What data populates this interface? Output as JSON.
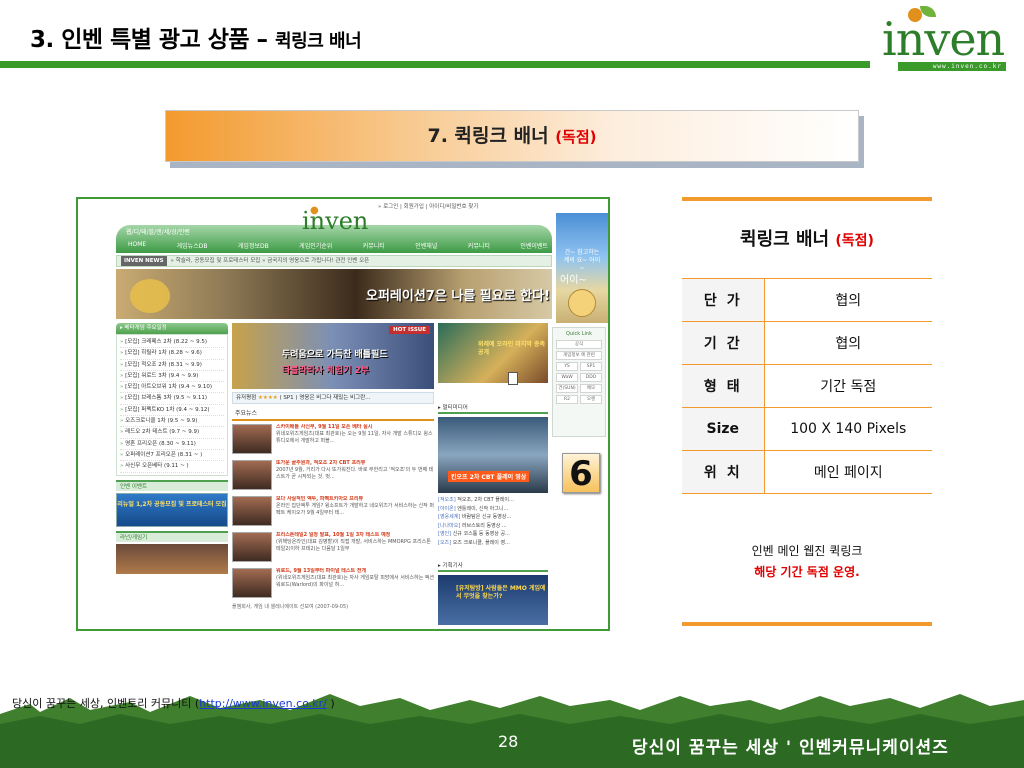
{
  "header": {
    "title": "3. 인벤 특별 광고 상품 –",
    "subtitle": "퀵링크 배너",
    "logo_text": "nven",
    "logo_url": "www.inven.co.kr"
  },
  "product": {
    "label": "7. 퀵링크 배너",
    "tag": "(독점)"
  },
  "badge": "6",
  "spec": {
    "title": "퀵링크 배너",
    "title_tag": "(독점)",
    "rows": [
      {
        "key": "단가",
        "value": "협의"
      },
      {
        "key": "기간",
        "value": "협의"
      },
      {
        "key": "형태",
        "value": "기간 독점"
      },
      {
        "key": "Size",
        "value": "100 X 140 Pixels"
      },
      {
        "key": "위치",
        "value": "메인 페이지"
      }
    ],
    "desc1": "인벤 메인 웹진 퀵링크",
    "desc2": "해당 기간 독점 운영."
  },
  "footer": {
    "note_prefix": "당신이 꿈꾸는 세상, 인벤토리 커뮤니티 (",
    "note_link": "http://www.inven.co.kr/",
    "note_suffix": " )",
    "page_number": "28",
    "slogan": "당신이 꿈꾸는 세상 ' 인벤커뮤니케이션즈"
  },
  "mock": {
    "top_links": "» 로그인 | 회원가입 | 아이디/비밀번호 찾기",
    "nav_breadcrumb": "웹/디/돼/블/앤/세/상/인벤",
    "nav": [
      "HOME",
      "게임뉴스DB",
      "게임정보DB",
      "게임인기순위",
      "커뮤니티",
      "인벤채널",
      "커뮤니티",
      "인벤이벤트"
    ],
    "ticker_label": "INVEN NEWS",
    "ticker_text": "» 학슬라, 공동모집 및 프로테스터 모집   » 금국지의 영웅으로 가립니다! 관전 인벤 오픈",
    "hero_text": "오퍼레이션7은 나를 필요로 한다!",
    "sidebar_head": "▸ 베타게임 주요일정",
    "sidebar_items": [
      "[모집] 크레페스 2차 (8.22 ~ 9.5)",
      "[모집] 히릴라 1차 (8.28 ~ 9.6)",
      "[모집] 적오조 2차 (8.31 ~ 9.9)",
      "[모집] 워로드 3차 (9.4 ~ 9.9)",
      "[모집] 아트오브워 1차 (9.4 ~ 9.10)",
      "[모집] 브레스톰 3차 (9.5 ~ 9.11)",
      "[모집] 퍼펙트KO 1차 (9.4 ~ 9.12)",
      "오즈크로니클 1차 (9.5 ~ 9.9)",
      "레드오 2차 테스트 (9.7 ~ 9.9)",
      "영혼 프리오픈 (8.30 ~ 9.11)",
      "오퍼레이션7 프리오픈 (8.31 ~ )",
      "사신무 오픈베타 (9.11 ~ )"
    ],
    "event_head": "인벤 이벤트",
    "event_text": "리뉴얼 1,2차 공동모집 및 프로테스터 모집",
    "game_head": "라넌/게임기",
    "hot_tag": "HOT ISSUE",
    "hot_line1": "두려움으로 가득찬 배틀필드",
    "hot_line2": "타블라라사 체험기 2부",
    "rating_label": "유저평점",
    "rating_stars": "★★★★",
    "rating_text": "( SP1 ) 영웅은 비그다 재밌는 비그란...",
    "news_head": "주요뉴스",
    "news": [
      {
        "title": "스카이배틀 사신무, 9월 11일 오픈 베타 실시",
        "body": "위네오위즈게임즈(대표 최관호)는 오는 9월 11일, 자사 개발 스튜디오 윙스튜디오에서 개발하고 퍼블...",
        "foot": ""
      },
      {
        "title": "또가운 골주원과, 적오조 2차 CBT 프리뷰",
        "body": "2007년 9월, 거리가 다시 또가워진다. 바로 무한리고 '적오조'의 두 번째 테스트가 곧 시작되는 것. 벗...",
        "foot": ""
      },
      {
        "title": "보다 사실적인 액투, 파펙트키아오 프리뷰",
        "body": "온라인 집단액투 게임? 윙소프트가 개발하고 네오위즈가 서비스하는 신작 퍼펙트 케이오가 9월 4일부터 테...",
        "foot": ""
      },
      {
        "title": "프리스톤테일2 일정 발표, 10월 1일 3차 테스트 예정",
        "body": "(위해당온라인(대표 김병할)이 직접 개발, 서비스하는 MMORPG 프리스톤테일2(이하 프테2)는 다음달 1일부",
        "foot": ""
      },
      {
        "title": "워로드, 9월 13일부터 파이널 테스트 전개",
        "body": "(위네오위즈게임즈(대표 최관호)는 자사 게임포탈 피망에서 서비스하는 액션 워로드(Warlord)의 파이널 혀...",
        "foot": ""
      }
    ],
    "news_last": "플챔회사, 게임 내 셀레니에이트 선보여",
    "news_last_date": "(2007-09-05)",
    "col3_img_text": "위레에 오라인 마지막 종족 공개",
    "guide_head": "▸ 멀티미디어",
    "video_label": "킨오프 2차 CBT 플레이 영상",
    "col3_list": [
      {
        "tag": "[적오조]",
        "text": "적오조, 2차 CBT 플레이..."
      },
      {
        "tag": "[아이온]",
        "text": "엔틀레이, 신작 아그니..."
      },
      {
        "tag": "[영웅세계]",
        "text": "바람탐은 신규 동영상..."
      },
      {
        "tag": "[나나마오]",
        "text": "러브스토리 동영상 ..."
      },
      {
        "tag": "[영인]",
        "text": "신규 코스튬 등 동영상 공..."
      },
      {
        "tag": "[오즈]",
        "text": "오즈 크로니클, 플레이 영..."
      }
    ],
    "gi_head": "▸ 기획기사",
    "col3_ad_text": "[유저탐방] 사람들은 MMO 게임에서 무엇을 찾는가?",
    "ad_text1": "간~ 참고하는 계의 요~ 어이~",
    "ad_text2": "어이~",
    "ql_title": "Quick Link",
    "ql_items": [
      "공식",
      "게임정보 에 관련",
      "YS",
      "SP1",
      "WaW",
      "DDO",
      "건(SUN)",
      "메모",
      "R2",
      "오렌"
    ]
  }
}
